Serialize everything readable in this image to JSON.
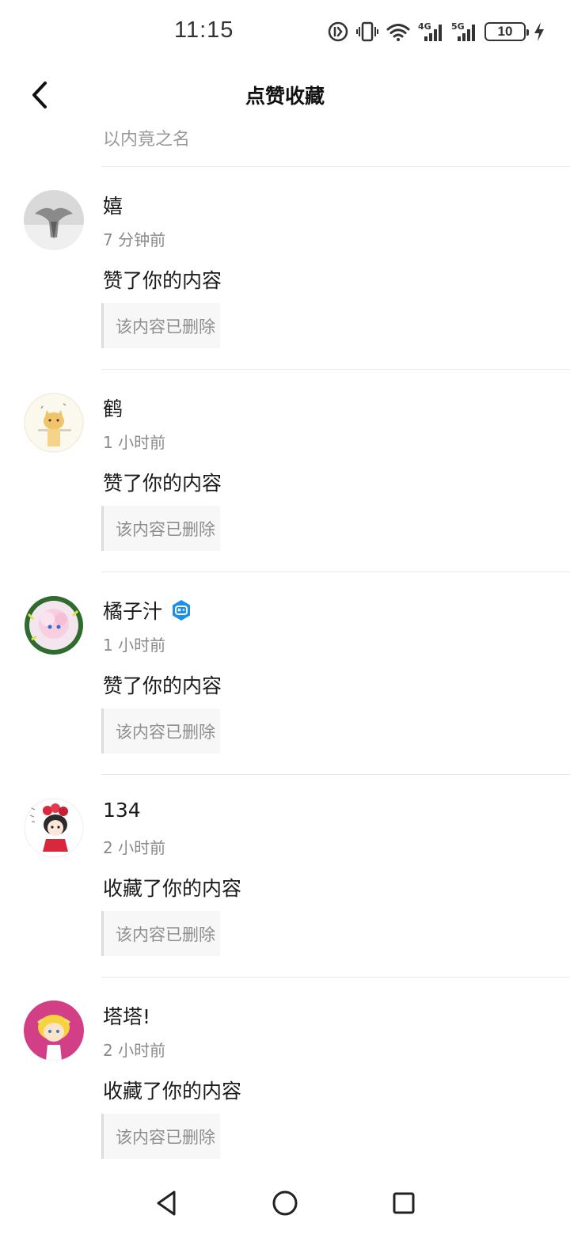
{
  "status_bar": {
    "time": "11:15",
    "signal_4g": "4G",
    "signal_5g": "5G",
    "battery": "10",
    "icons": [
      "notification-icon",
      "vibrate-icon",
      "wifi-icon",
      "signal-4g-icon",
      "signal-5g-icon",
      "battery-icon",
      "charging-icon"
    ]
  },
  "header": {
    "title": "点赞收藏",
    "back_icon": "chevron-left-icon"
  },
  "partial_item": {
    "text": "以内竟之名"
  },
  "notifications": [
    {
      "username": "嬉",
      "time": "7 分钟前",
      "action": "赞了你的内容",
      "quote": "该内容已删除",
      "verified": false,
      "avatar": "gray-avatar"
    },
    {
      "username": "鹤",
      "time": "1 小时前",
      "action": "赞了你的内容",
      "quote": "该内容已删除",
      "verified": false,
      "avatar": "cat-avatar"
    },
    {
      "username": "橘子汁",
      "time": "1 小时前",
      "action": "赞了你的内容",
      "quote": "该内容已删除",
      "verified": true,
      "avatar": "wreath-avatar"
    },
    {
      "username": "134",
      "time": "2 小时前",
      "action": "收藏了你的内容",
      "quote": "该内容已删除",
      "verified": false,
      "avatar": "girl-avatar"
    },
    {
      "username": "塔塔!",
      "time": "2 小时前",
      "action": "收藏了你的内容",
      "quote": "该内容已删除",
      "verified": false,
      "avatar": "pink-avatar"
    }
  ],
  "nav_bar": {
    "icons": [
      "back-triangle-icon",
      "home-circle-icon",
      "recents-square-icon"
    ]
  },
  "colors": {
    "badge": "#1e8fe6",
    "divider": "#e8e8e8",
    "secondary_text": "#8a8a8a"
  }
}
